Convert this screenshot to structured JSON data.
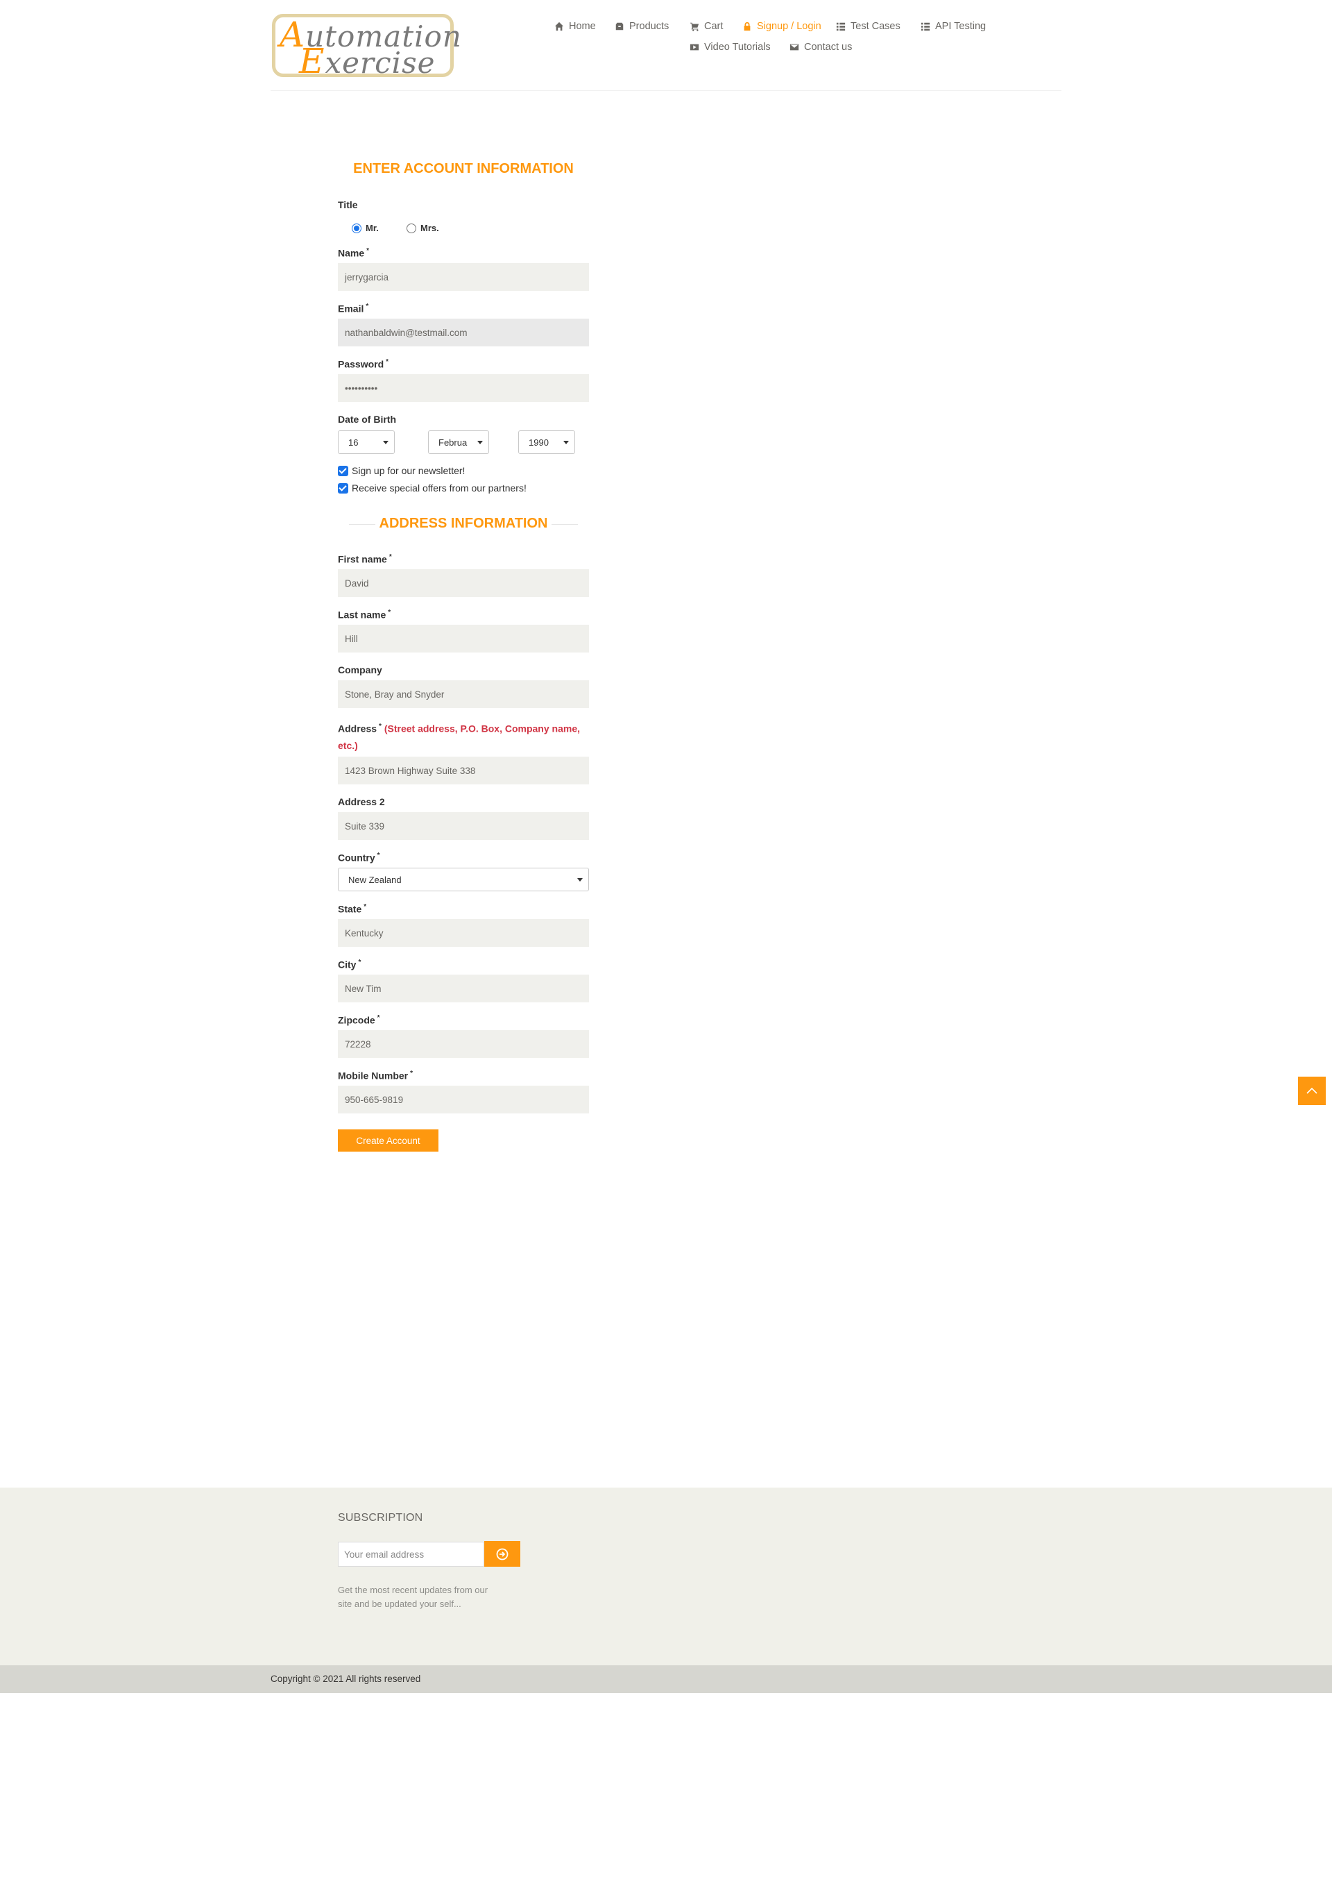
{
  "logo": {
    "line1_cap": "A",
    "line1_rest": "utomation",
    "line2_cap": "E",
    "line2_rest": "xercise"
  },
  "nav": {
    "home": "Home",
    "products": "Products",
    "cart": "Cart",
    "signup_login": "Signup / Login",
    "test_cases": "Test Cases",
    "api_testing": "API Testing",
    "video_tutorials": "Video Tutorials",
    "contact_us": "Contact us"
  },
  "account": {
    "heading": "ENTER ACCOUNT INFORMATION",
    "title_label": "Title",
    "title_options": [
      "Mr.",
      "Mrs."
    ],
    "title_selected": "Mr.",
    "name_label": "Name",
    "name_value": "jerrygarcia",
    "email_label": "Email",
    "email_value": "nathanbaldwin@testmail.com",
    "password_label": "Password",
    "password_value": "••••••••••",
    "dob_label": "Date of Birth",
    "dob_day": "16",
    "dob_month": "Februa",
    "dob_year": "1990",
    "newsletter_label": "Sign up for our newsletter!",
    "newsletter_checked": true,
    "offers_label": "Receive special offers from our partners!",
    "offers_checked": true
  },
  "address": {
    "heading": "ADDRESS INFORMATION",
    "first_name_label": "First name",
    "first_name_value": "David",
    "last_name_label": "Last name",
    "last_name_value": "Hill",
    "company_label": "Company",
    "company_value": "Stone, Bray and Snyder",
    "address_label": "Address",
    "address_hint": "(Street address, P.O. Box, Company name, etc.)",
    "address_value": "1423 Brown Highway Suite 338",
    "address2_label": "Address 2",
    "address2_value": "Suite 339",
    "country_label": "Country",
    "country_value": "New Zealand",
    "state_label": "State",
    "state_value": "Kentucky",
    "city_label": "City",
    "city_value": "New Tim",
    "zipcode_label": "Zipcode",
    "zipcode_value": "72228",
    "mobile_label": "Mobile Number",
    "mobile_value": "950-665-9819",
    "required_mark": "*",
    "create_button": "Create Account"
  },
  "footer": {
    "subscription_title": "SUBSCRIPTION",
    "email_placeholder": "Your email address",
    "subscription_text": "Get the most recent updates from our site and be updated your self...",
    "copyright": "Copyright © 2021 All rights reserved"
  },
  "colors": {
    "accent": "#fe980f",
    "error": "#d13545",
    "field_bg": "#f0f0ec",
    "footer_bg": "#f0f0e9",
    "footer_bottom_bg": "#d6d6d0"
  },
  "icons": {
    "home": "home-icon",
    "products": "products-icon",
    "cart": "cart-icon",
    "signup": "lock-icon",
    "test_cases": "list-icon",
    "api_testing": "list-icon",
    "video": "youtube-play-icon",
    "contact": "envelope-icon",
    "scroll_up": "chevron-up-icon",
    "subscribe": "arrow-circle-right-icon"
  }
}
